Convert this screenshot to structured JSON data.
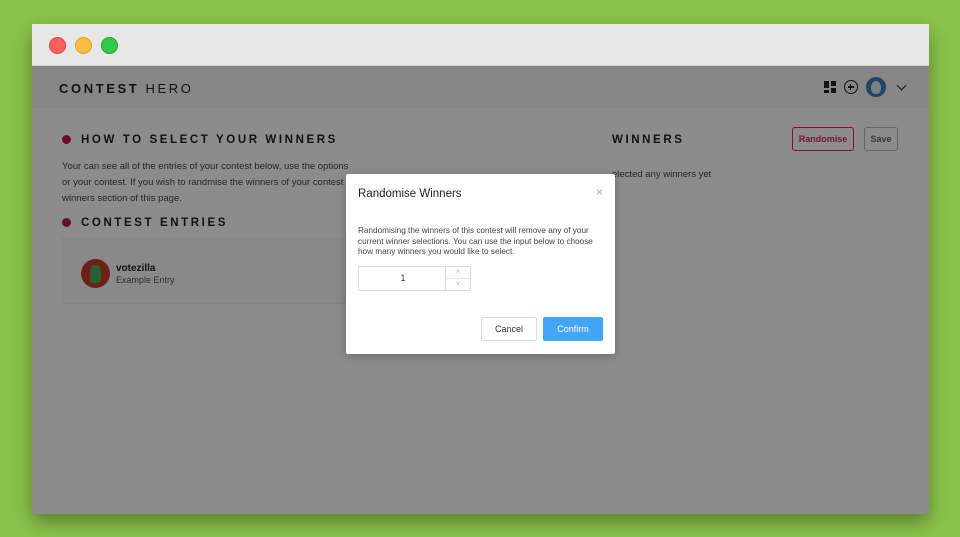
{
  "window": {
    "traffic_lights": [
      "close",
      "minimize",
      "maximize"
    ]
  },
  "header": {
    "brand_bold": "CONTEST",
    "brand_light": "HERO"
  },
  "left": {
    "how_title": "HOW TO SELECT YOUR WINNERS",
    "help_lines": [
      "Your can see all of the entries of your contest below, use the options",
      "or your contest. If you wish to randmise the winners of your contest",
      "winners section of this page."
    ],
    "entries_title": "CONTEST ENTRIES",
    "entry": {
      "name": "votezilla",
      "subtitle": "Example Entry"
    }
  },
  "right": {
    "winners_title": "WINNERS",
    "no_winners_text": "elected any winners yet",
    "randomise_label": "Randomise",
    "save_label": "Save"
  },
  "modal": {
    "title": "Randomise Winners",
    "close_glyph": "×",
    "body": "Randomising the winners of this contest will remove any of your current winner selections. You can use the input below to choose how many winners you would like to select.",
    "count_value": "1",
    "step_up": "˄",
    "step_down": "˅",
    "cancel_label": "Cancel",
    "confirm_label": "Confirm"
  },
  "colors": {
    "accent": "#e91e63",
    "primary": "#42a5f5",
    "background": "#8bc34a"
  }
}
